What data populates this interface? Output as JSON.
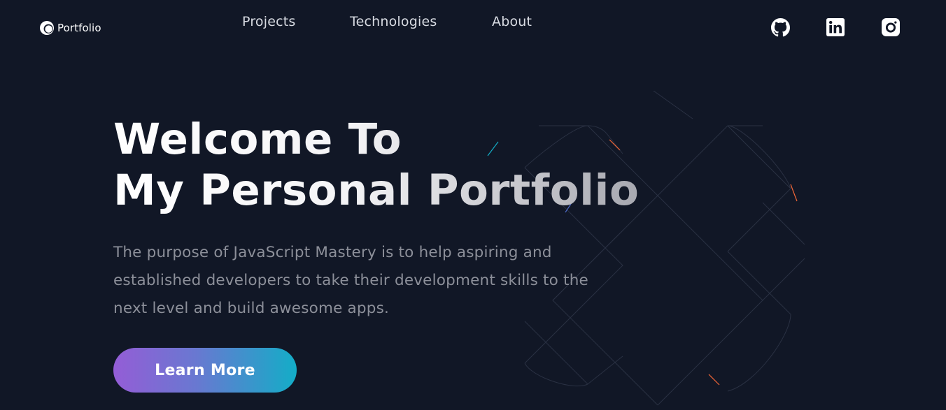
{
  "header": {
    "brand_label": "Portfolio",
    "brand_icon": "portfolio-logo-icon",
    "nav": [
      {
        "label": "Projects"
      },
      {
        "label": "Technologies"
      },
      {
        "label": "About"
      }
    ],
    "social": [
      {
        "icon": "github-icon"
      },
      {
        "icon": "linkedin-icon"
      },
      {
        "icon": "instagram-icon"
      }
    ]
  },
  "hero": {
    "title_line1": "Welcome To",
    "title_line2": "My Personal Portfolio",
    "description": "The purpose of JavaScript Mastery is to help aspiring and established developers to take their development skills to the next level and build awesome apps.",
    "cta_label": "Learn More"
  },
  "colors": {
    "background": "#111726",
    "nav_text": "#d8dbe2",
    "description_text": "#8c8f99",
    "cta_gradient_start": "#945dd6",
    "cta_gradient_mid": "#6978d1",
    "cta_gradient_end": "#13adc7",
    "accent_orange": "#f46737",
    "accent_teal": "#13adc7"
  }
}
